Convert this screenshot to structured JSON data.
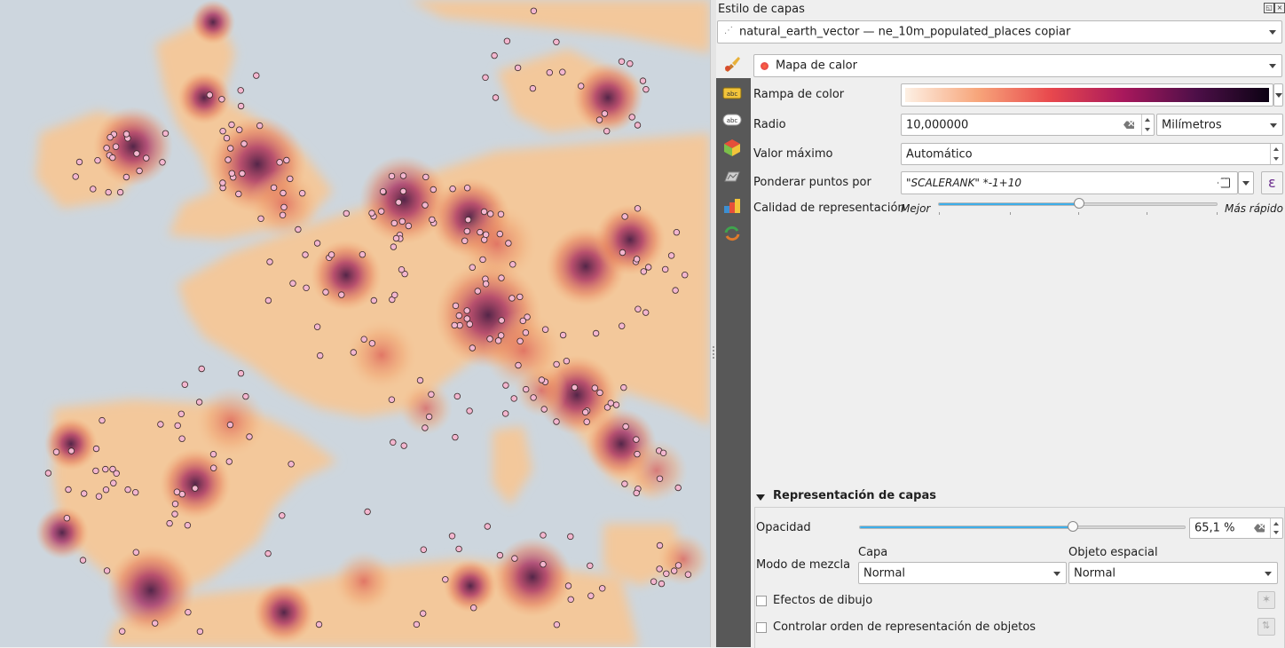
{
  "panel": {
    "title": "Estilo de capas",
    "layer_combo": "natural_earth_vector — ne_10m_populated_places copiar",
    "renderer_combo": "Mapa de calor",
    "color_ramp_label": "Rampa de color",
    "color_ramp_colors": [
      "#fdf0e4",
      "#f7a57a",
      "#e8484d",
      "#a8185c",
      "#4d0f48",
      "#0c0213"
    ],
    "radius_label": "Radio",
    "radius_value": "10,000000",
    "radius_unit": "Milímetros",
    "max_value_label": "Valor máximo",
    "max_value_value": "Automático",
    "weight_label": "Ponderar puntos por",
    "weight_value": "\"SCALERANK\" *-1+10",
    "quality_label": "Calidad de representación",
    "quality_left": "Mejor",
    "quality_right": "Más rápido",
    "quality_level": 0.5,
    "epsilon_symbol": "ε"
  },
  "sidebar": {
    "icons": [
      "symbology-icon",
      "labels-icon",
      "masks-icon",
      "3d-view-icon",
      "diagrams-icon",
      "rendering-icon",
      "history-icon"
    ]
  },
  "layer_rendering": {
    "header": "Representación de capas",
    "opacity_label": "Opacidad",
    "opacity_value": "65,1 %",
    "opacity_level": 0.651,
    "blend_label": "Modo de mezcla",
    "layer_label": "Capa",
    "feature_label": "Objeto espacial",
    "layer_blend": "Normal",
    "feature_blend": "Normal",
    "draw_effects": "Efectos de dibujo",
    "control_order": "Controlar orden de representación de objetos"
  },
  "map": {
    "sea_color": "#cdd6de",
    "land_color": "#f3c89b",
    "point_color": "#f3b6cf"
  }
}
